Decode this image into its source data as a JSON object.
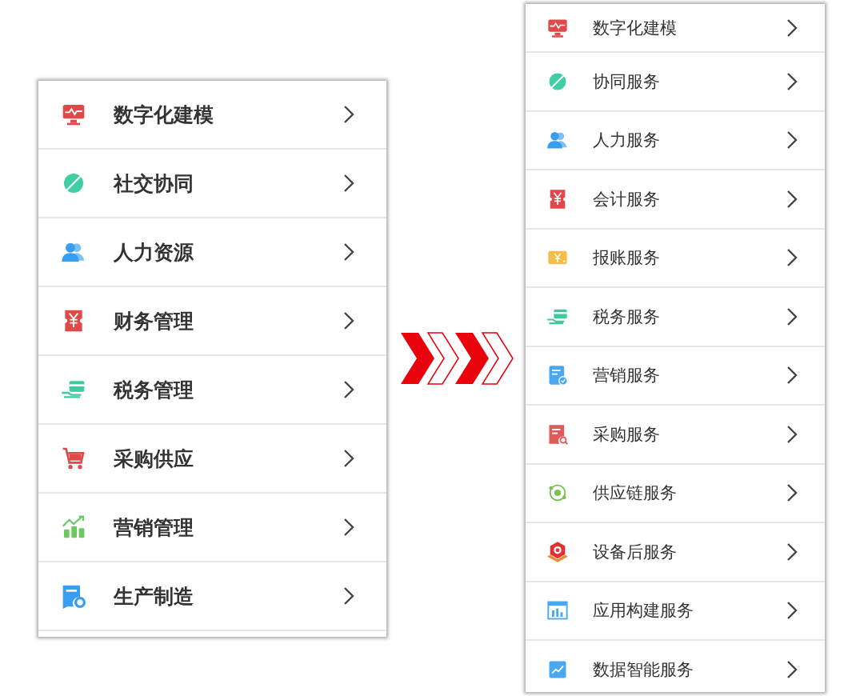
{
  "left_menu": {
    "items": [
      {
        "label": "数字化建模",
        "kind": "monitor"
      },
      {
        "label": "社交协同",
        "kind": "planet"
      },
      {
        "label": "人力资源",
        "kind": "people"
      },
      {
        "label": "财务管理",
        "kind": "ticket"
      },
      {
        "label": "税务管理",
        "kind": "hand"
      },
      {
        "label": "采购供应",
        "kind": "cart"
      },
      {
        "label": "营销管理",
        "kind": "growth"
      },
      {
        "label": "生产制造",
        "kind": "docgear"
      }
    ]
  },
  "right_menu": {
    "items": [
      {
        "label": "数字化建模",
        "kind": "monitor"
      },
      {
        "label": "协同服务",
        "kind": "planet"
      },
      {
        "label": "人力服务",
        "kind": "people"
      },
      {
        "label": "会计服务",
        "kind": "ticket"
      },
      {
        "label": "报账服务",
        "kind": "card"
      },
      {
        "label": "税务服务",
        "kind": "hand"
      },
      {
        "label": "营销服务",
        "kind": "doccheck"
      },
      {
        "label": "采购服务",
        "kind": "docsearch"
      },
      {
        "label": "供应链服务",
        "kind": "orbit"
      },
      {
        "label": "设备后服务",
        "kind": "hexagon"
      },
      {
        "label": "应用构建服务",
        "kind": "window"
      },
      {
        "label": "数据智能服务",
        "kind": "tile"
      }
    ]
  }
}
